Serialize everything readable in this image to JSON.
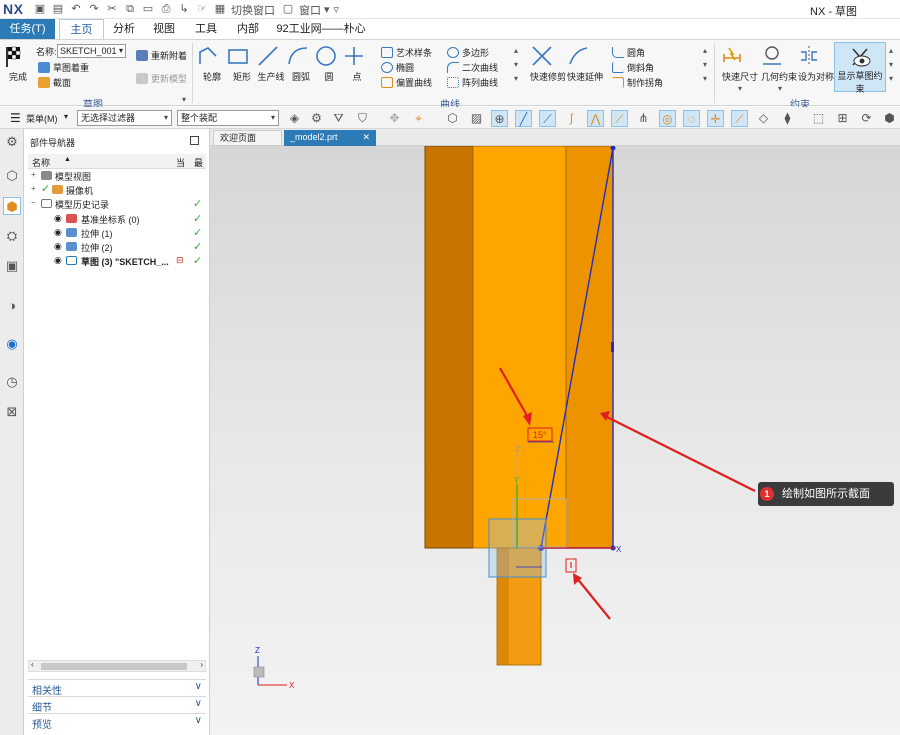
{
  "titlebar": {
    "logo": "NX",
    "switch_window": "切换窗口",
    "window_menu": "窗口",
    "title": "NX - 草图"
  },
  "ribbon_tabs": [
    "任务(T)",
    "主页",
    "分析",
    "视图",
    "工具",
    "内部",
    "92工业网——朴心"
  ],
  "ribbon": {
    "sketch_group": {
      "finish": "完成",
      "name_label": "名称:",
      "name_value": "SKETCH_001",
      "orient_sketch": "草图着重",
      "reattach": "重新附着",
      "section": "截面",
      "update_model": "更新模型",
      "label": "草图"
    },
    "curve_group": {
      "big": [
        "轮廓",
        "矩形",
        "生产线",
        "圆弧",
        "圆",
        "点"
      ],
      "small_col1": [
        "艺术样条",
        "椭圆",
        "偏置曲线"
      ],
      "small_col2": [
        "多边形",
        "二次曲线",
        "阵列曲线"
      ],
      "trim": [
        "快速修剪",
        "快速延伸"
      ],
      "corner": [
        "圆角",
        "倒斜角",
        "制作拐角"
      ],
      "label": "曲线"
    },
    "constraint_group": {
      "buttons": [
        "快速尺寸",
        "几何约束",
        "设为对称",
        "显示草图约束"
      ],
      "label": "约束"
    }
  },
  "toolbar": {
    "menu": "菜单(M)",
    "filter": "无选择过滤器",
    "assembly_scope": "整个装配"
  },
  "navigator": {
    "title": "部件导航器",
    "columns": {
      "name": "名称",
      "current": "当",
      "latest": "最"
    },
    "rows": [
      {
        "label": "模型视图"
      },
      {
        "label": "摄像机"
      },
      {
        "label": "模型历史记录"
      },
      {
        "label": "基准坐标系 (0)"
      },
      {
        "label": "拉伸 (1)"
      },
      {
        "label": "拉伸 (2)"
      },
      {
        "label": "草图 (3) \"SKETCH_..."
      }
    ],
    "sections": [
      "相关性",
      "细节",
      "预览"
    ]
  },
  "doc_tabs": [
    "欢迎页面",
    "_model2.prt"
  ],
  "viewport": {
    "dim_label": "15°",
    "axis_labels": {
      "x": "X",
      "y": "Y",
      "z": "Z"
    }
  },
  "callout": {
    "number": "1",
    "text": "绘制如图所示截面"
  },
  "colors": {
    "part_orange": "#FFA500",
    "part_dark": "#C87400",
    "sketch_blue": "#1F2DBF",
    "annotation_red": "#E02020",
    "accent_blue": "#2C7BB6"
  }
}
